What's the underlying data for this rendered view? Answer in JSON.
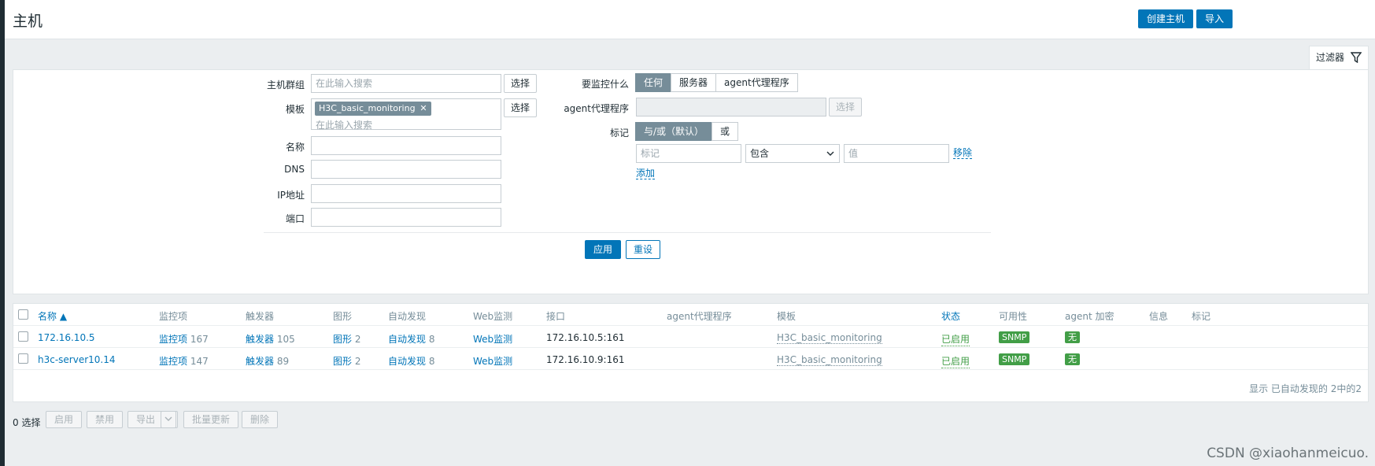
{
  "header": {
    "title": "主机",
    "create_host_label": "创建主机",
    "import_label": "导入"
  },
  "filter": {
    "tab_label": "过滤器",
    "host_group_label": "主机群组",
    "host_group_placeholder": "在此输入搜索",
    "select_label": "选择",
    "template_label": "模板",
    "template_chip": "H3C_basic_monitoring",
    "template_placeholder": "在此输入搜索",
    "name_label": "名称",
    "dns_label": "DNS",
    "ip_label": "IP地址",
    "port_label": "端口",
    "monitored_by_label": "要监控什么",
    "monitored_by_options": [
      "任何",
      "服务器",
      "agent代理程序"
    ],
    "proxy_label": "agent代理程序",
    "tags_label": "标记",
    "tags_mode_options": [
      "与/或（默认）",
      "或"
    ],
    "tag_placeholder": "标记",
    "tag_operator": "包含",
    "value_placeholder": "值",
    "remove_label": "移除",
    "add_label": "添加",
    "apply_label": "应用",
    "reset_label": "重设"
  },
  "table": {
    "headers": {
      "name": "名称 ▲",
      "items": "监控项",
      "triggers": "触发器",
      "graphs": "图形",
      "discovery": "自动发现",
      "web": "Web监测",
      "interface": "接口",
      "proxy": "agent代理程序",
      "templates": "模板",
      "status": "状态",
      "availability": "可用性",
      "encryption": "agent 加密",
      "info": "信息",
      "tags": "标记"
    },
    "rows": [
      {
        "name": "172.16.10.5",
        "items_label": "监控项",
        "items_count": "167",
        "triggers_label": "触发器",
        "triggers_count": "105",
        "graphs_label": "图形",
        "graphs_count": "2",
        "discovery_label": "自动发现",
        "discovery_count": "8",
        "web_label": "Web监测",
        "interface": "172.16.10.5:161",
        "template": "H3C_basic_monitoring",
        "status": "已启用",
        "availability": "SNMP",
        "encryption": "无"
      },
      {
        "name": "h3c-server10.14",
        "items_label": "监控项",
        "items_count": "147",
        "triggers_label": "触发器",
        "triggers_count": "89",
        "graphs_label": "图形",
        "graphs_count": "2",
        "discovery_label": "自动发现",
        "discovery_count": "8",
        "web_label": "Web监测",
        "interface": "172.16.10.9:161",
        "template": "H3C_basic_monitoring",
        "status": "已启用",
        "availability": "SNMP",
        "encryption": "无"
      }
    ],
    "footer_note": "显示 已自动发现的 2中的2"
  },
  "actions": {
    "selected_count": "0 选择",
    "enable_label": "启用",
    "disable_label": "禁用",
    "export_label": "导出",
    "mass_update_label": "批量更新",
    "delete_label": "删除"
  },
  "watermark": "CSDN @xiaohanmeicuo.",
  "colors": {
    "primary": "#0275b8",
    "success": "#429e47",
    "chip": "#768d99"
  }
}
